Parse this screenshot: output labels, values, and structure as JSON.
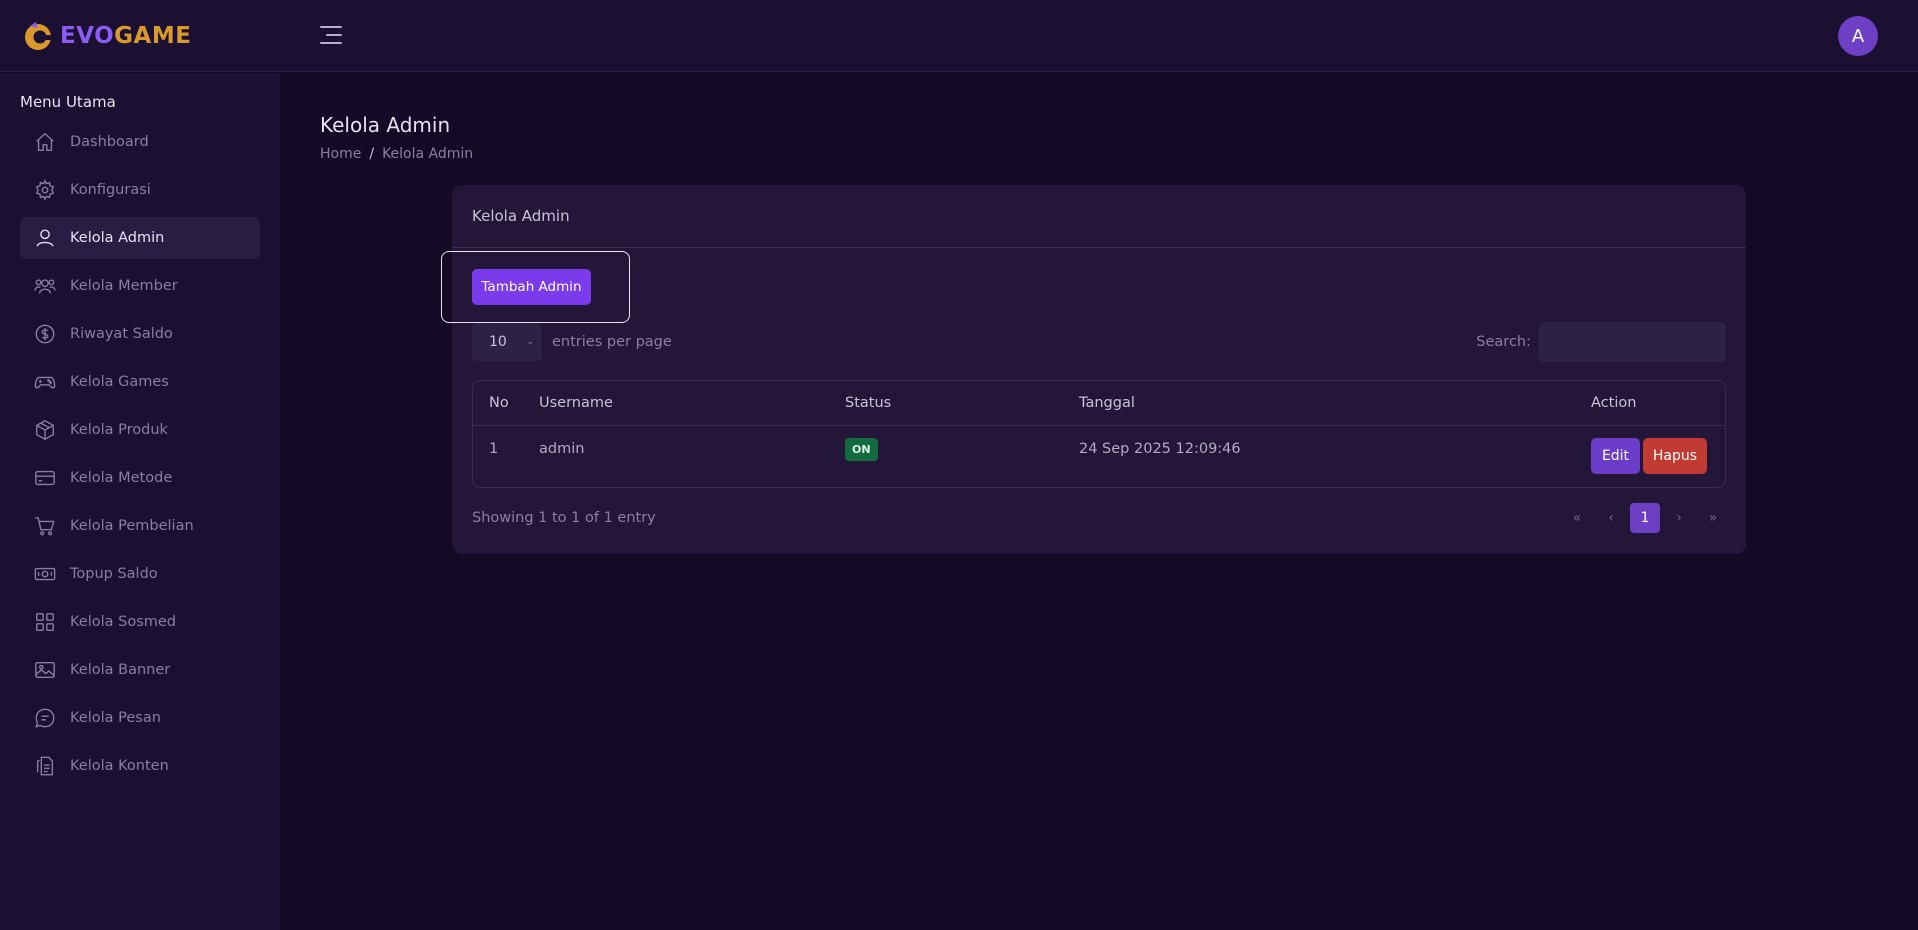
{
  "brand": {
    "evo": "EVO",
    "game": "GAME"
  },
  "header": {
    "avatar_initial": "A"
  },
  "sidebar": {
    "title": "Menu Utama",
    "items": [
      {
        "label": "Dashboard",
        "icon": "home-icon"
      },
      {
        "label": "Konfigurasi",
        "icon": "gear-icon"
      },
      {
        "label": "Kelola Admin",
        "icon": "user-icon",
        "active": true
      },
      {
        "label": "Kelola Member",
        "icon": "users-icon"
      },
      {
        "label": "Riwayat Saldo",
        "icon": "dollar-icon"
      },
      {
        "label": "Kelola Games",
        "icon": "gamepad-icon"
      },
      {
        "label": "Kelola Produk",
        "icon": "box-icon"
      },
      {
        "label": "Kelola Metode",
        "icon": "card-icon"
      },
      {
        "label": "Kelola Pembelian",
        "icon": "cart-icon"
      },
      {
        "label": "Topup Saldo",
        "icon": "cash-icon"
      },
      {
        "label": "Kelola Sosmed",
        "icon": "grid-icon"
      },
      {
        "label": "Kelola Banner",
        "icon": "image-icon"
      },
      {
        "label": "Kelola Pesan",
        "icon": "chat-icon"
      },
      {
        "label": "Kelola Konten",
        "icon": "document-icon"
      }
    ]
  },
  "page": {
    "title": "Kelola Admin",
    "breadcrumb": {
      "home": "Home",
      "separator": "/",
      "current": "Kelola Admin"
    }
  },
  "card": {
    "title": "Kelola Admin",
    "add_button": "Tambah Admin",
    "entries": {
      "value": "10",
      "label": "entries per page"
    },
    "search": {
      "label": "Search:",
      "value": ""
    },
    "table": {
      "columns": [
        "No",
        "Username",
        "Status",
        "Tanggal",
        "Action"
      ],
      "rows": [
        {
          "no": "1",
          "username": "admin",
          "status": "ON",
          "tanggal": "24 Sep 2025 12:09:46"
        }
      ],
      "actions": {
        "edit": "Edit",
        "delete": "Hapus"
      }
    },
    "footer": {
      "showing": "Showing 1 to 1 of 1 entry",
      "pager": {
        "first": "«",
        "prev": "‹",
        "current": "1",
        "next": "›",
        "last": "»"
      }
    }
  },
  "colors": {
    "accent": "#7c3aed",
    "brand_evo": "#8b5cf6",
    "brand_game": "#d99a2b",
    "status_on": "#116b3e",
    "danger": "#c23b32"
  }
}
